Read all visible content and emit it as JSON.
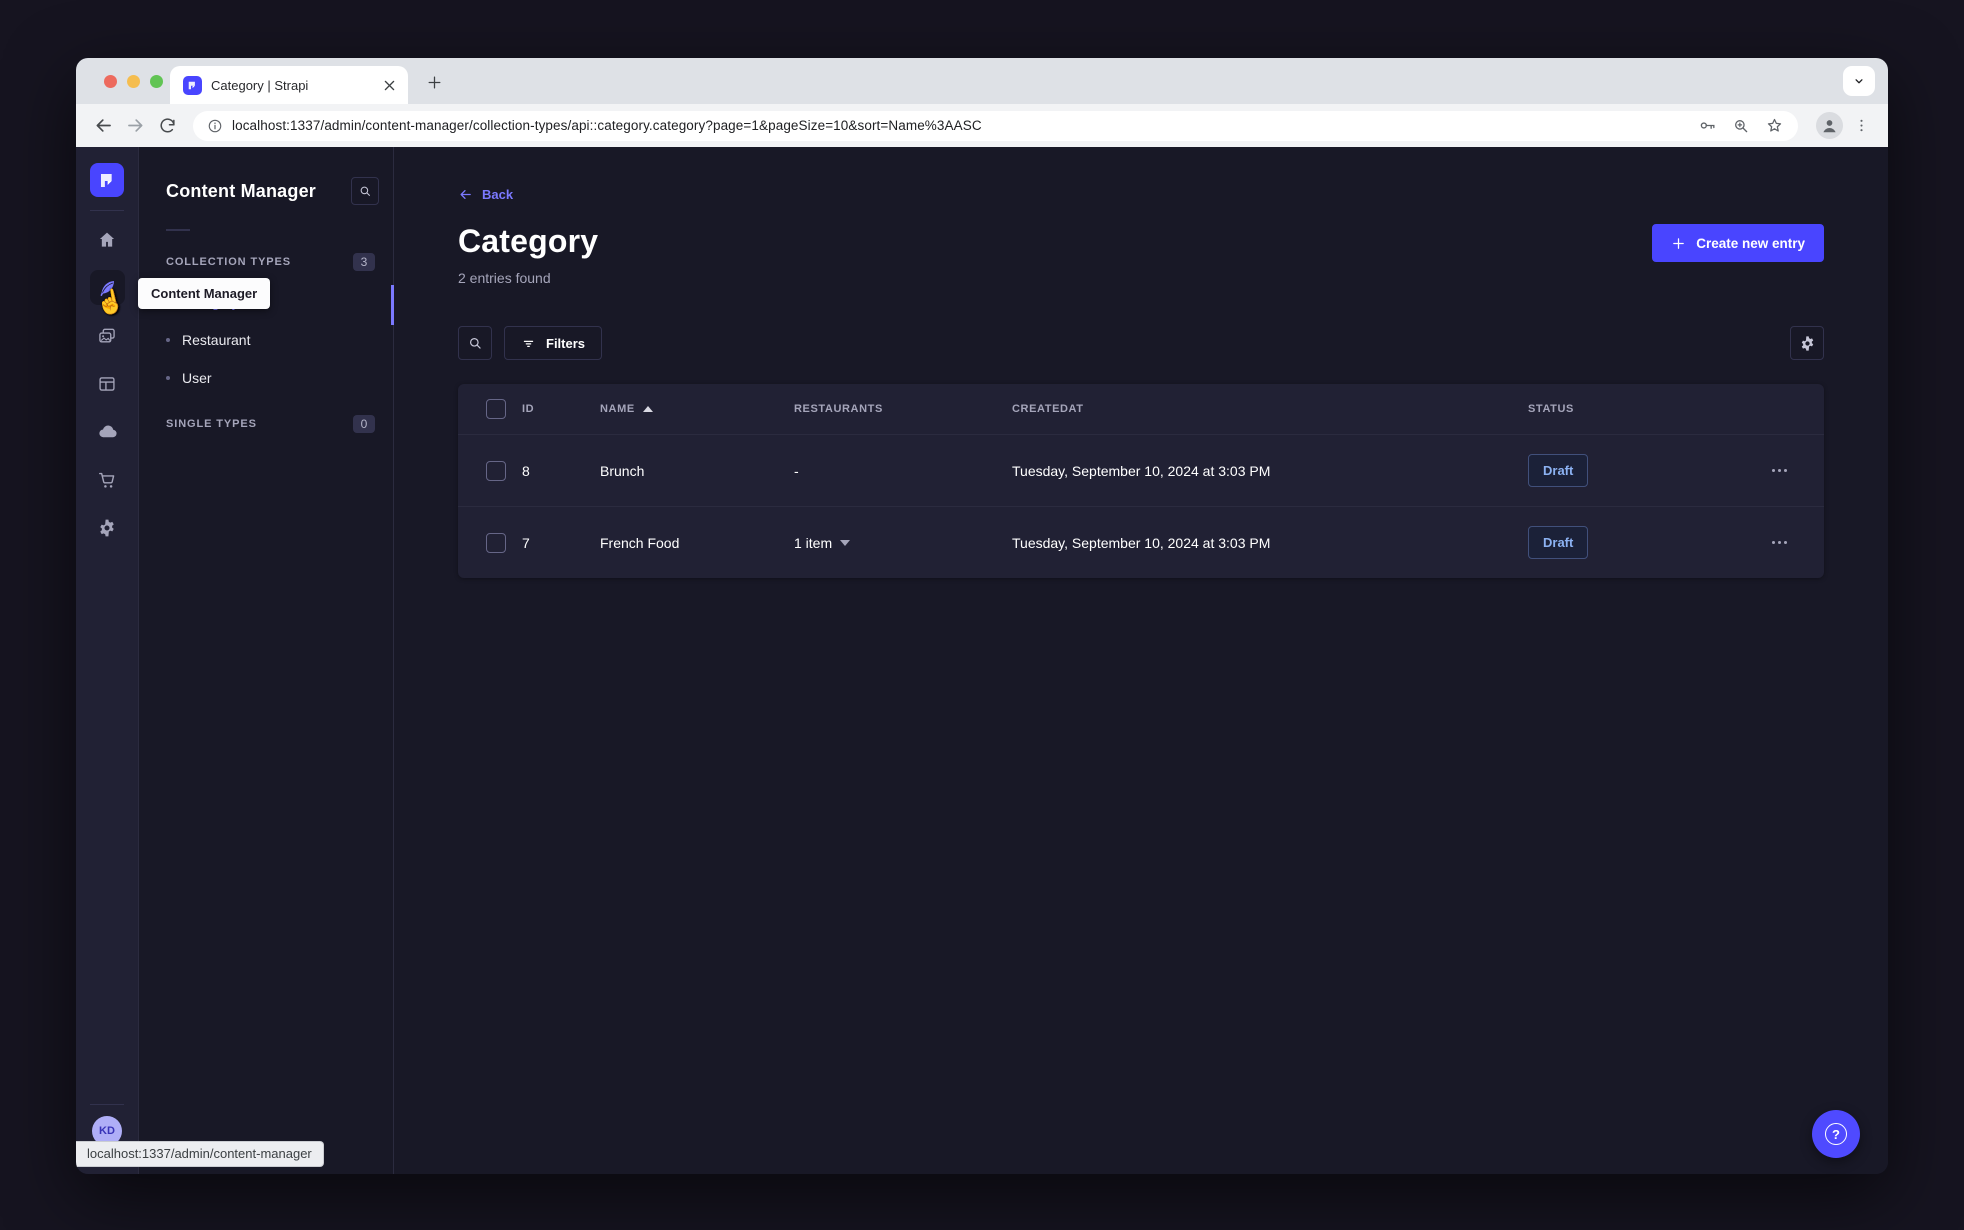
{
  "browser": {
    "tab": {
      "title": "Category | Strapi"
    },
    "url": "localhost:1337/admin/content-manager/collection-types/api::category.category?page=1&pageSize=10&sort=Name%3AASC",
    "status_bubble": "localhost:1337/admin/content-manager"
  },
  "nav_rail": {
    "tooltip": "Content Manager",
    "avatar_initials": "KD"
  },
  "subnav": {
    "title": "Content Manager",
    "collection_types": {
      "label": "COLLECTION TYPES",
      "count": "3",
      "items": [
        "Category",
        "Restaurant",
        "User"
      ]
    },
    "single_types": {
      "label": "SINGLE TYPES",
      "count": "0"
    }
  },
  "main": {
    "back": "Back",
    "title": "Category",
    "subtitle": "2 entries found",
    "create_button": "Create new entry",
    "filters_button": "Filters",
    "help_glyph": "?",
    "table": {
      "headers": {
        "id": "ID",
        "name": "NAME",
        "restaurants": "RESTAURANTS",
        "createdat": "CREATEDAT",
        "status": "STATUS"
      },
      "rows": [
        {
          "id": "8",
          "name": "Brunch",
          "restaurants": "-",
          "createdat": "Tuesday, September 10, 2024 at 3:03 PM",
          "status": "Draft"
        },
        {
          "id": "7",
          "name": "French Food",
          "restaurants": "1 item",
          "createdat": "Tuesday, September 10, 2024 at 3:03 PM",
          "status": "Draft"
        }
      ]
    }
  },
  "colors": {
    "primary": "#4945FF",
    "primary_light": "#7B79FF",
    "page_bg": "#181826",
    "card_bg": "#212134",
    "draft_text": "#8CB2F2",
    "draft_border": "#41507B",
    "text_muted": "#A5A5BA"
  }
}
